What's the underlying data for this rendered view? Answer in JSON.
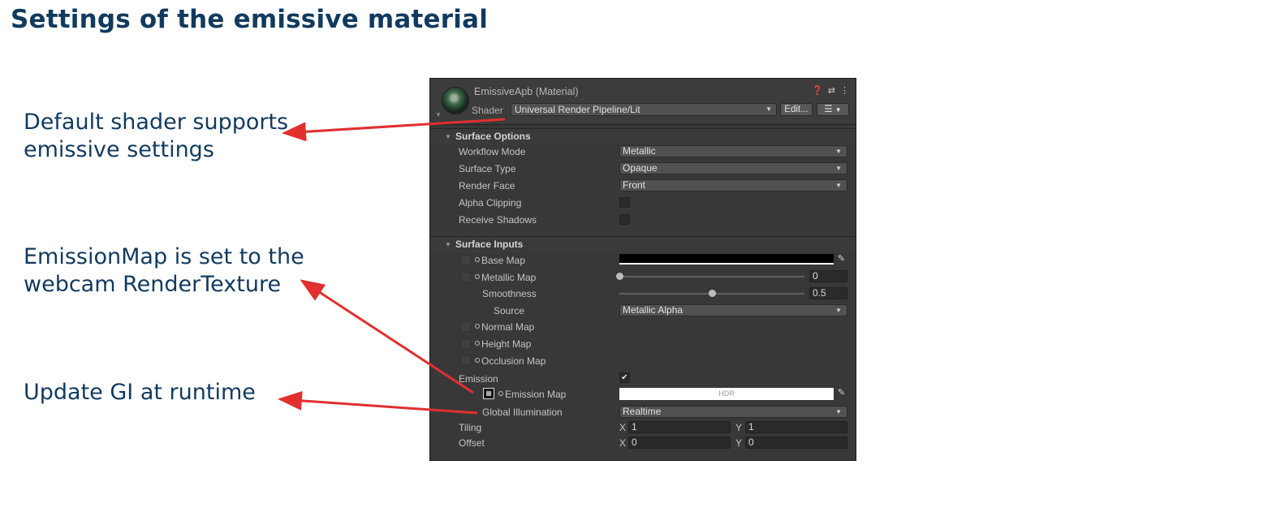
{
  "slide": {
    "title": "Settings of the emissive material",
    "callouts": [
      {
        "lines": [
          "Default shader supports",
          "emissive settings"
        ]
      },
      {
        "lines": [
          "EmissionMap is set to the",
          "webcam RenderTexture"
        ]
      },
      {
        "lines": [
          "Update GI at runtime"
        ]
      }
    ],
    "arrow_color": "#e03030"
  },
  "inspector": {
    "material_title": "EmissiveApb (Material)",
    "header_icons": [
      "help-icon",
      "preset-icon",
      "more-icon"
    ],
    "shader_label": "Shader",
    "shader_value": "Universal Render Pipeline/Lit",
    "edit_button": "Edit...",
    "menu_button": "☰",
    "surface_options": {
      "title": "Surface Options",
      "workflow_mode": {
        "label": "Workflow Mode",
        "value": "Metallic"
      },
      "surface_type": {
        "label": "Surface Type",
        "value": "Opaque"
      },
      "render_face": {
        "label": "Render Face",
        "value": "Front"
      },
      "alpha_clipping": {
        "label": "Alpha Clipping",
        "checked": false
      },
      "receive_shadows": {
        "label": "Receive Shadows",
        "checked": false
      }
    },
    "surface_inputs": {
      "title": "Surface Inputs",
      "base_map": {
        "label": "Base Map",
        "color": "#000000"
      },
      "metallic_map": {
        "label": "Metallic Map",
        "value": "0",
        "fraction": 0.0
      },
      "smoothness": {
        "label": "Smoothness",
        "value": "0.5",
        "fraction": 0.5
      },
      "source": {
        "label": "Source",
        "value": "Metallic Alpha"
      },
      "normal_map": {
        "label": "Normal Map"
      },
      "height_map": {
        "label": "Height Map"
      },
      "occlusion_map": {
        "label": "Occlusion Map"
      },
      "emission": {
        "label": "Emission",
        "checked": true
      },
      "emission_map": {
        "label": "Emission Map",
        "hdr_label": "HDR",
        "color": "#ffffff"
      },
      "global_illumination": {
        "label": "Global Illumination",
        "value": "Realtime"
      },
      "tiling": {
        "label": "Tiling",
        "x_label": "X",
        "x": "1",
        "y_label": "Y",
        "y": "1"
      },
      "offset": {
        "label": "Offset",
        "x_label": "X",
        "x": "0",
        "y_label": "Y",
        "y": "0"
      }
    }
  }
}
